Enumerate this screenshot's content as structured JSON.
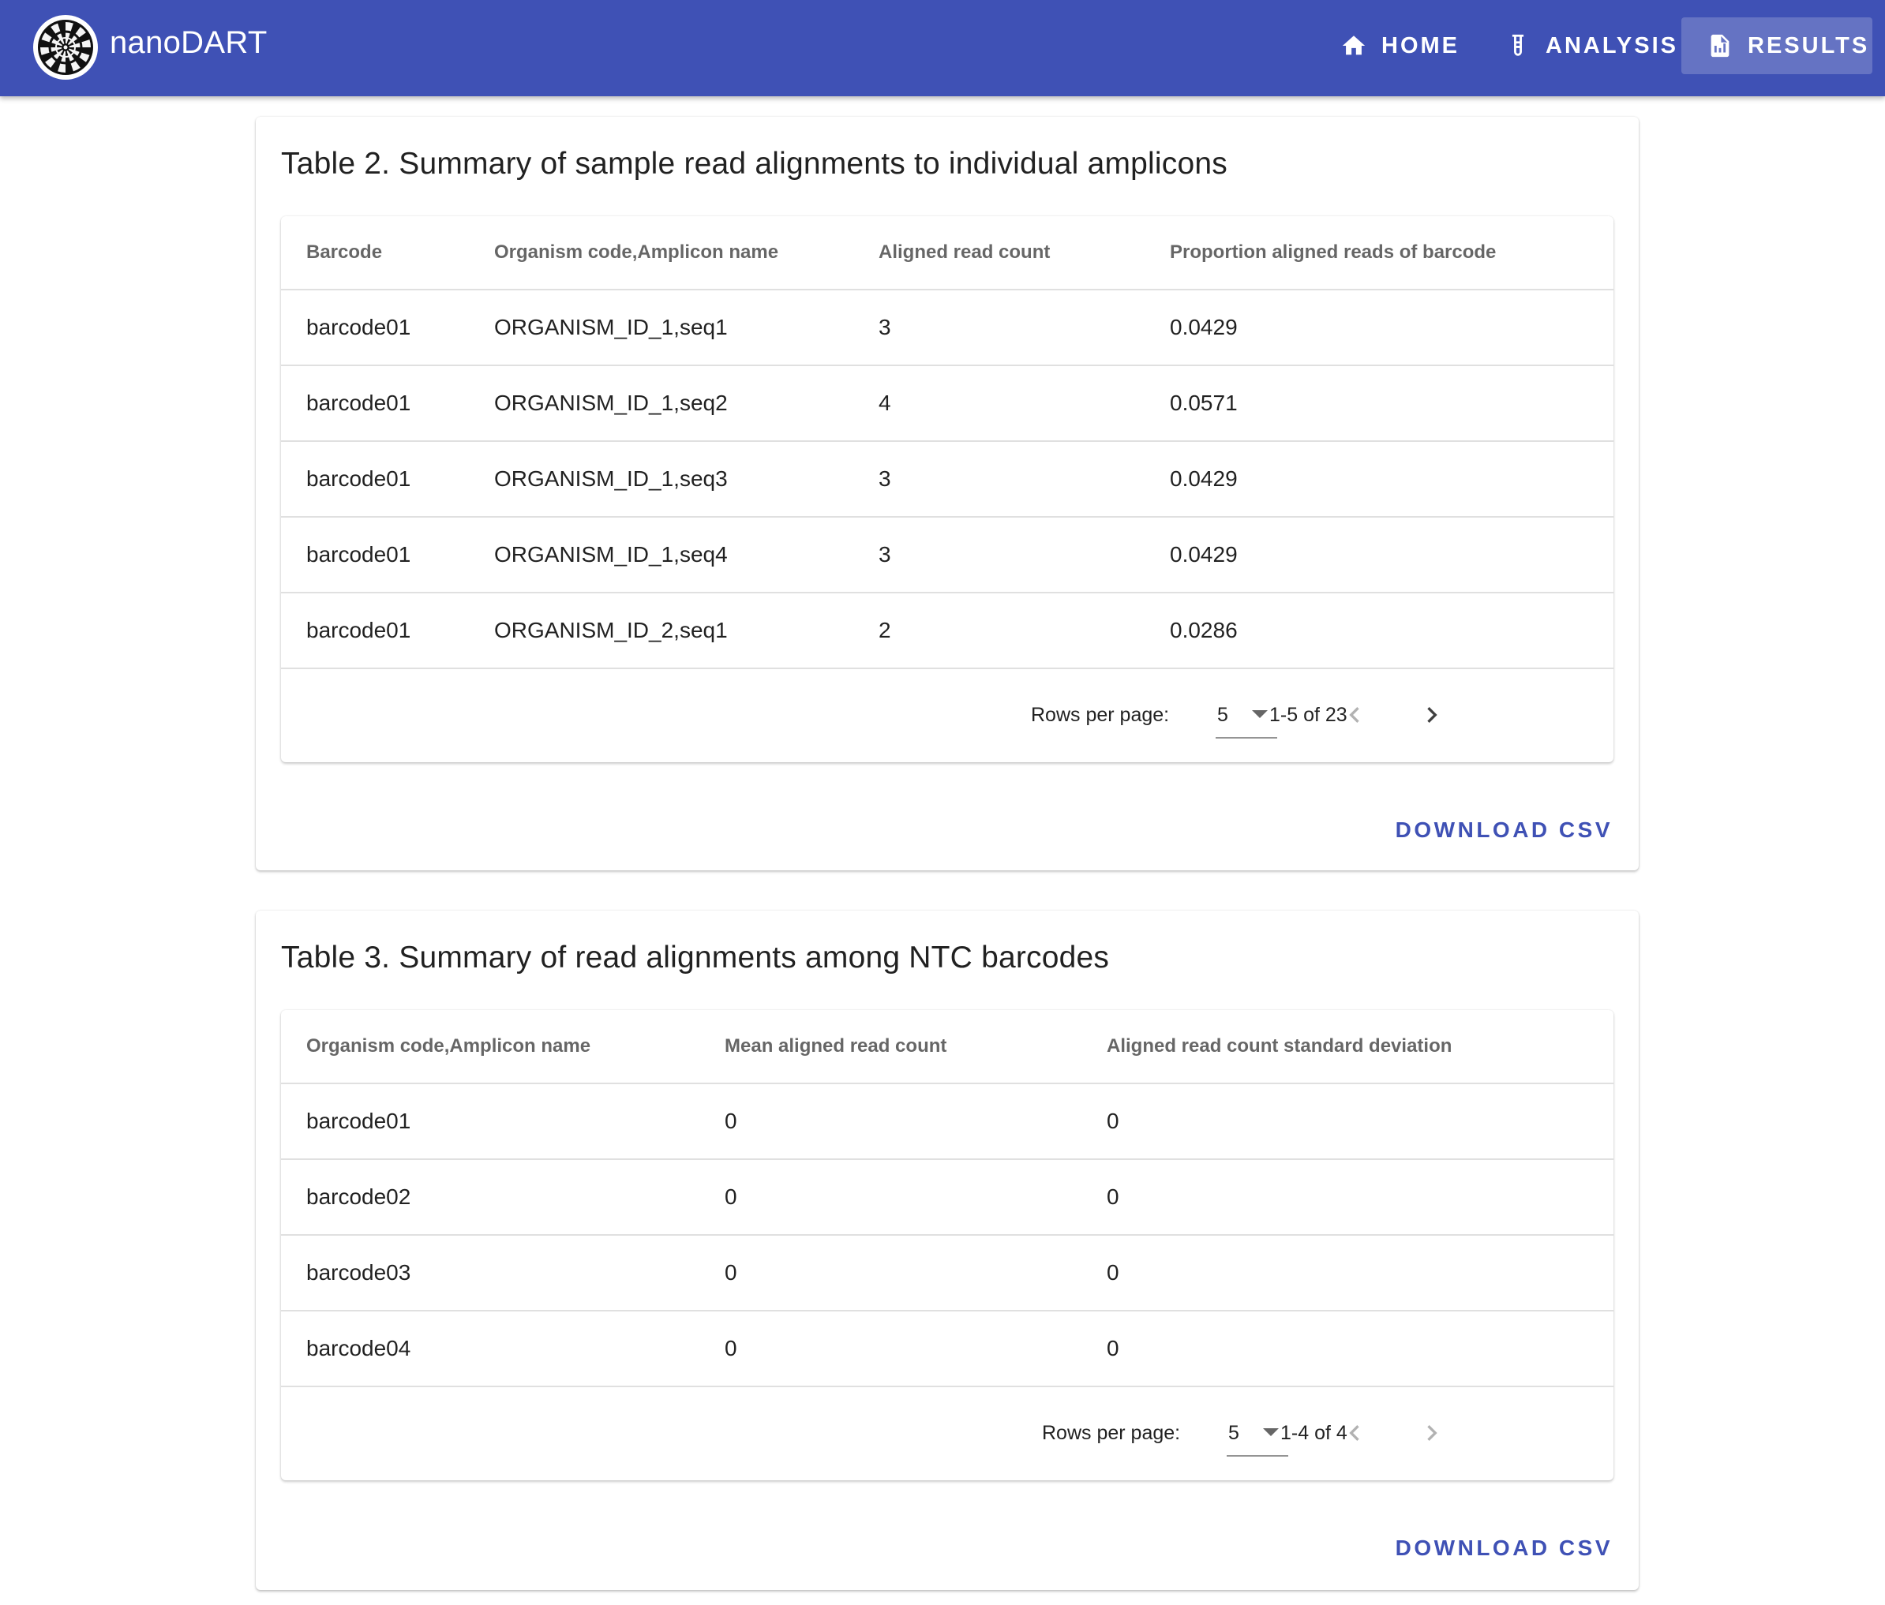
{
  "app": {
    "title": "nanoDART",
    "nav": [
      {
        "label": "HOME",
        "icon": "home-icon"
      },
      {
        "label": "ANALYSIS",
        "icon": "test-tube-icon"
      },
      {
        "label": "RESULTS",
        "icon": "report-icon"
      }
    ]
  },
  "table2": {
    "title": "Table 2. Summary of sample read alignments to individual amplicons",
    "headers": [
      "Barcode",
      "Organism code,Amplicon name",
      "Aligned read count",
      "Proportion aligned reads of barcode"
    ],
    "rows": [
      [
        "barcode01",
        "ORGANISM_ID_1,seq1",
        "3",
        "0.0429"
      ],
      [
        "barcode01",
        "ORGANISM_ID_1,seq2",
        "4",
        "0.0571"
      ],
      [
        "barcode01",
        "ORGANISM_ID_1,seq3",
        "3",
        "0.0429"
      ],
      [
        "barcode01",
        "ORGANISM_ID_1,seq4",
        "3",
        "0.0429"
      ],
      [
        "barcode01",
        "ORGANISM_ID_2,seq1",
        "2",
        "0.0286"
      ]
    ],
    "pagination": {
      "rows_per_page_label": "Rows per page:",
      "rows_per_page": "5",
      "range": "1-5 of 23"
    },
    "download_label": "DOWNLOAD CSV"
  },
  "table3": {
    "title": "Table 3. Summary of read alignments among NTC barcodes",
    "headers": [
      "Organism code,Amplicon name",
      "Mean aligned read count",
      "Aligned read count standard deviation"
    ],
    "rows": [
      [
        "barcode01",
        "0",
        "0"
      ],
      [
        "barcode02",
        "0",
        "0"
      ],
      [
        "barcode03",
        "0",
        "0"
      ],
      [
        "barcode04",
        "0",
        "0"
      ]
    ],
    "pagination": {
      "rows_per_page_label": "Rows per page:",
      "rows_per_page": "5",
      "range": "1-4 of 4"
    },
    "download_label": "DOWNLOAD CSV"
  },
  "colors": {
    "primary": "#3f51b5",
    "text": "#212121",
    "muted": "#757575",
    "divider": "#e0e0e0"
  }
}
